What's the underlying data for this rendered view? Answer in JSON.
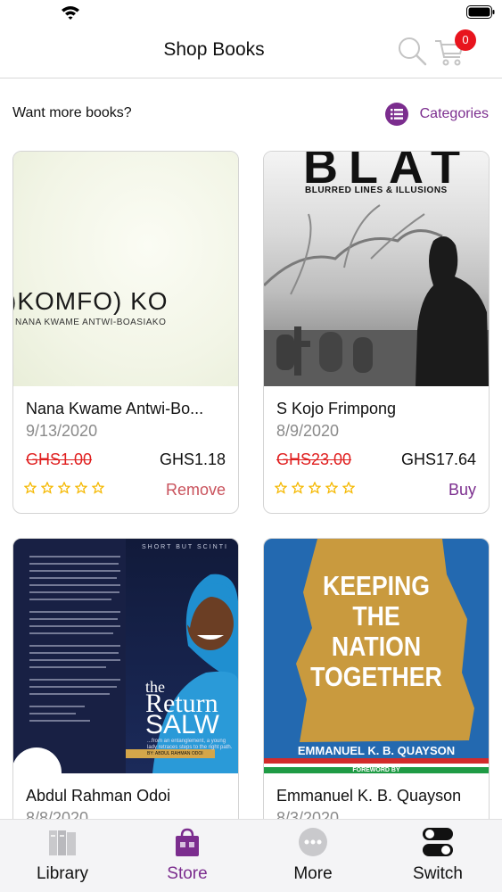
{
  "header": {
    "title": "Shop Books",
    "cart_count": "0"
  },
  "promo": {
    "text": "Want more books?",
    "categories_label": "Categories"
  },
  "books": [
    {
      "author": "Nana Kwame Antwi-Boasiako",
      "author_display": "Nana Kwame Antwi-Bo...",
      "date": "9/13/2020",
      "old_price": "GHS1.00",
      "price": "GHS1.18",
      "action": "Remove",
      "rating": 0,
      "cover": {
        "title": ")KOMFO) KO",
        "author": "NANA KWAME ANTWI-BOASIAKO"
      }
    },
    {
      "author": "S Kojo Frimpong",
      "date": "8/9/2020",
      "old_price": "GHS23.00",
      "price": "GHS17.64",
      "action": "Buy",
      "rating": 0,
      "cover": {
        "title": "BLAT",
        "subtitle": "BLURRED LINES & ILLUSIONS"
      }
    },
    {
      "author": "Abdul Rahman Odoi",
      "date": "8/8/2020",
      "cover": {
        "tag": "SHORT BUT SCINTI",
        "title_1": "the",
        "title_2": "Return",
        "title_3": "SALW",
        "tagline": "...from an entanglement, a young lady retraces steps to the right path.",
        "byline": "BY: ABDUL RAHMAN ODOI"
      }
    },
    {
      "author": "Emmanuel K. B. Quayson",
      "date": "8/3/2020",
      "cover": {
        "title_1": "KEEPING",
        "title_2": "THE",
        "title_3": "NATION",
        "title_4": "TOGETHER",
        "author": "EMMANUEL K. B. QUAYSON",
        "foreword": "FOREWORD BY"
      }
    }
  ],
  "tabs": [
    {
      "label": "Library",
      "icon": "library-icon"
    },
    {
      "label": "Store",
      "icon": "store-icon",
      "active": true
    },
    {
      "label": "More",
      "icon": "more-icon"
    },
    {
      "label": "Switch",
      "icon": "switch-icon"
    }
  ],
  "colors": {
    "accent": "#7b2d8e",
    "badge": "#e8141d",
    "strike": "#e02020",
    "remove": "#c9525c",
    "star": "#f5b800"
  }
}
